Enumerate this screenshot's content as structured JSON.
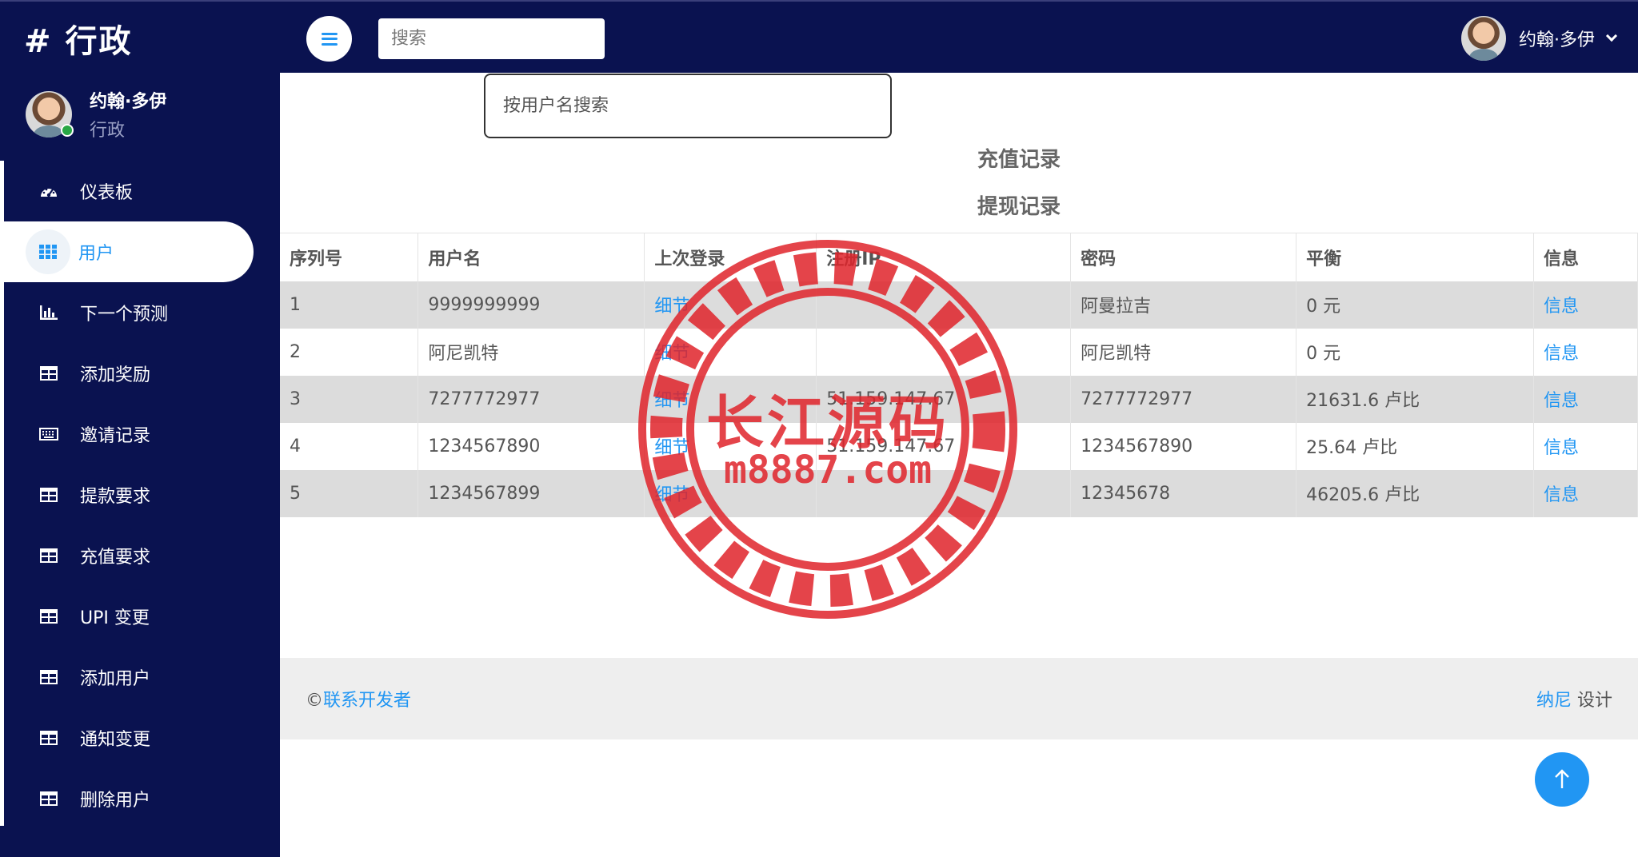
{
  "brand": {
    "title": "# 行政"
  },
  "topbar": {
    "search_placeholder": "搜索",
    "user_name": "约翰·多伊"
  },
  "sidebar": {
    "profile": {
      "name": "约翰·多伊",
      "role": "行政"
    },
    "items": [
      {
        "label": "仪表板",
        "icon": "dashboard-icon"
      },
      {
        "label": "用户",
        "icon": "grid-icon",
        "active": true
      },
      {
        "label": "下一个预测",
        "icon": "bar-chart-icon"
      },
      {
        "label": "添加奖励",
        "icon": "table-icon"
      },
      {
        "label": "邀请记录",
        "icon": "keyboard-icon"
      },
      {
        "label": "提款要求",
        "icon": "table-icon"
      },
      {
        "label": "充值要求",
        "icon": "table-icon"
      },
      {
        "label": "UPI 变更",
        "icon": "table-icon"
      },
      {
        "label": "添加用户",
        "icon": "table-icon"
      },
      {
        "label": "通知变更",
        "icon": "table-icon"
      },
      {
        "label": "删除用户",
        "icon": "table-icon"
      }
    ]
  },
  "main": {
    "user_search_placeholder": "按用户名搜索",
    "links": {
      "recharge": "充值记录",
      "withdraw": "提现记录"
    },
    "table": {
      "headers": [
        "序列号",
        "用户名",
        "上次登录",
        "注册IP",
        "密码",
        "平衡",
        "信息"
      ],
      "rows": [
        {
          "no": "1",
          "username": "9999999999",
          "last_login": "细节",
          "reg_ip": "",
          "password": "阿曼拉吉",
          "balance": "0 元",
          "info": "信息"
        },
        {
          "no": "2",
          "username": "阿尼凯特",
          "last_login": "细节",
          "reg_ip": "",
          "password": "阿尼凯特",
          "balance": "0 元",
          "info": "信息"
        },
        {
          "no": "3",
          "username": "7277772977",
          "last_login": "细节",
          "reg_ip": "51.159.147.67",
          "password": "7277772977",
          "balance": "21631.6 卢比",
          "info": "信息"
        },
        {
          "no": "4",
          "username": "1234567890",
          "last_login": "细节",
          "reg_ip": "51.159.147.67",
          "password": "1234567890",
          "balance": "25.64 卢比",
          "info": "信息"
        },
        {
          "no": "5",
          "username": "1234567899",
          "last_login": "细节",
          "reg_ip": "",
          "password": "12345678",
          "balance": "46205.6 卢比",
          "info": "信息"
        }
      ]
    }
  },
  "footer": {
    "copyright_symbol": "©",
    "contact": "联系开发者",
    "credit_name": "纳尼",
    "credit_suffix": " 设计"
  },
  "watermark": {
    "line1": "长江源码",
    "line2": "m8887.com"
  },
  "colors": {
    "navy": "#0a1250",
    "accent": "#2196f3",
    "stripe": "#dcdcdc",
    "seal": "#e0242b"
  }
}
